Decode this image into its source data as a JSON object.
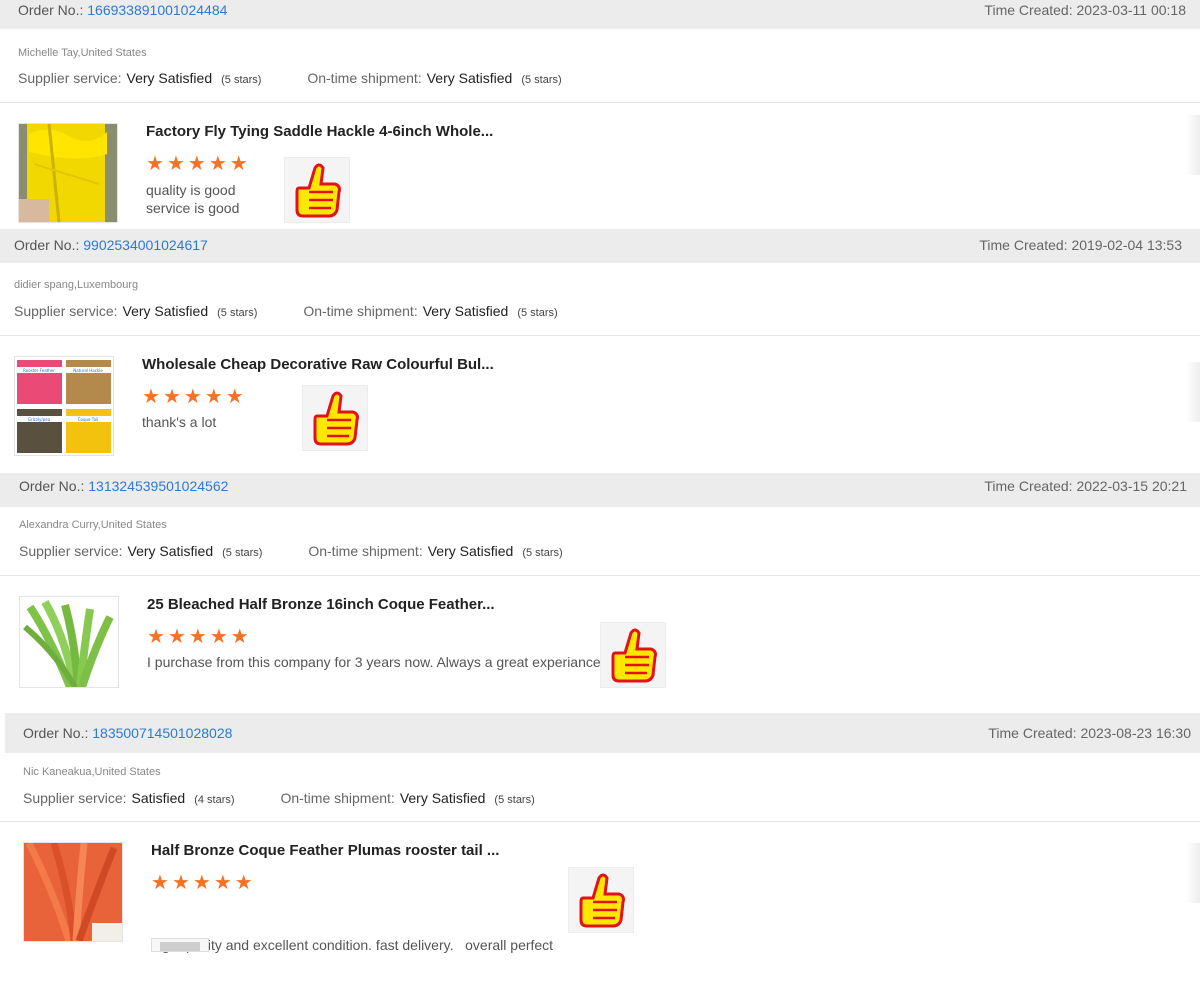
{
  "labels": {
    "order_no": "Order No.:",
    "time_created": "Time Created:",
    "supplier_service": "Supplier service:",
    "ontime_shipment": "On-time shipment:"
  },
  "reviews": [
    {
      "order_number": "166933891001024484",
      "time": "2023-03-11 00:18",
      "buyer": "Michelle Tay,United States",
      "supplier_value": "Very Satisfied",
      "supplier_stars": "(5 stars)",
      "shipment_value": "Very Satisfied",
      "shipment_stars": "(5 stars)",
      "product_title": "Factory Fly Tying Saddle Hackle 4-6inch Whole...",
      "rating": 5,
      "comment": [
        "quality is good",
        "service is good"
      ]
    },
    {
      "order_number": "9902534001024617",
      "time": "2019-02-04 13:53",
      "buyer": "didier spang,Luxembourg",
      "supplier_value": "Very Satisfied",
      "supplier_stars": "(5 stars)",
      "shipment_value": "Very Satisfied",
      "shipment_stars": "(5 stars)",
      "product_title": "Wholesale Cheap Decorative Raw Colourful Bul...",
      "rating": 5,
      "comment": [
        "thank's a lot"
      ],
      "product_image_labels": [
        "Rooster Feather",
        "Natural Hackle",
        "Grizzly/pea",
        "Coque Tail"
      ]
    },
    {
      "order_number": "131324539501024562",
      "time": "2022-03-15 20:21",
      "buyer": "Alexandra Curry,United States",
      "supplier_value": "Very Satisfied",
      "supplier_stars": "(5 stars)",
      "shipment_value": "Very Satisfied",
      "shipment_stars": "(5 stars)",
      "product_title": "25 Bleached Half Bronze 16inch Coque Feather...",
      "rating": 5,
      "comment": [
        "I purchase from this company for 3 years now. Always a great experiance."
      ]
    },
    {
      "order_number": "183500714501028028",
      "time": "2023-08-23 16:30",
      "buyer": "Nic Kaneakua,United States",
      "supplier_value": "Satisfied",
      "supplier_stars": "(4 stars)",
      "shipment_value": "Very Satisfied",
      "shipment_stars": "(5 stars)",
      "product_title": "Half Bronze Coque Feather Plumas rooster tail ...",
      "rating": 5,
      "comment": [
        "high quality and excellent condition. fast delivery.   overall perfect"
      ]
    }
  ],
  "icons": {
    "star": "star-icon",
    "thumbs_up": "thumbs-up-icon"
  },
  "colors": {
    "link": "#2b7ad6",
    "star": "#f57224",
    "order_bar": "#ececec"
  }
}
